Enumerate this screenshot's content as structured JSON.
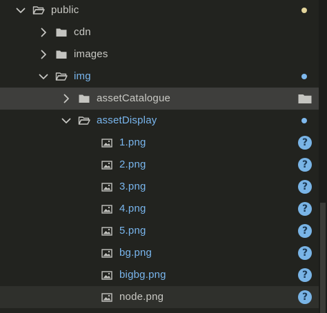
{
  "colors": {
    "background": "#22231f",
    "text_default": "#c9c9c4",
    "text_modified": "#79b6ee",
    "dot_modified": "#7fb9ee",
    "dot_untracked": "#e3d59b",
    "badge_untracked": "#79b4e6",
    "icon_folder": "#c4c4c0",
    "chevron": "#c8c8c4"
  },
  "tree": {
    "items": [
      {
        "label": "public",
        "depth": 0,
        "kind": "folder",
        "expanded": true,
        "color": "text_default",
        "status": "dot",
        "status_color": "dot_untracked",
        "state": ""
      },
      {
        "label": "cdn",
        "depth": 1,
        "kind": "folder",
        "expanded": false,
        "color": "text_default",
        "status": "",
        "state": ""
      },
      {
        "label": "images",
        "depth": 1,
        "kind": "folder",
        "expanded": false,
        "color": "text_default",
        "status": "",
        "state": ""
      },
      {
        "label": "img",
        "depth": 1,
        "kind": "folder",
        "expanded": true,
        "color": "text_modified",
        "status": "dot",
        "status_color": "dot_modified",
        "state": ""
      },
      {
        "label": "assetCatalogue",
        "depth": 2,
        "kind": "folder",
        "expanded": false,
        "color": "text_default",
        "status": "folder-action",
        "state": "selected"
      },
      {
        "label": "assetDisplay",
        "depth": 2,
        "kind": "folder",
        "expanded": true,
        "color": "text_modified",
        "status": "dot",
        "status_color": "dot_modified",
        "state": ""
      },
      {
        "label": "1.png",
        "depth": 3,
        "kind": "image",
        "color": "text_modified",
        "status": "badge",
        "badge": "?",
        "state": ""
      },
      {
        "label": "2.png",
        "depth": 3,
        "kind": "image",
        "color": "text_modified",
        "status": "badge",
        "badge": "?",
        "state": ""
      },
      {
        "label": "3.png",
        "depth": 3,
        "kind": "image",
        "color": "text_modified",
        "status": "badge",
        "badge": "?",
        "state": ""
      },
      {
        "label": "4.png",
        "depth": 3,
        "kind": "image",
        "color": "text_modified",
        "status": "badge",
        "badge": "?",
        "state": ""
      },
      {
        "label": "5.png",
        "depth": 3,
        "kind": "image",
        "color": "text_modified",
        "status": "badge",
        "badge": "?",
        "state": ""
      },
      {
        "label": "bg.png",
        "depth": 3,
        "kind": "image",
        "color": "text_modified",
        "status": "badge",
        "badge": "?",
        "state": ""
      },
      {
        "label": "bigbg.png",
        "depth": 3,
        "kind": "image",
        "color": "text_modified",
        "status": "badge",
        "badge": "?",
        "state": ""
      },
      {
        "label": "node.png",
        "depth": 3,
        "kind": "image",
        "color": "text_default",
        "status": "badge",
        "badge": "?",
        "state": "hover"
      }
    ]
  }
}
